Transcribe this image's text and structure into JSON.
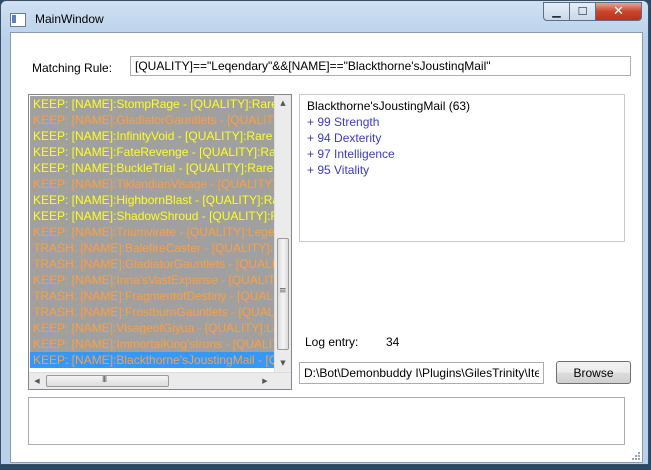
{
  "window": {
    "title": "MainWindow",
    "minimize_glyph": "▁",
    "maximize_glyph": "☐",
    "close_glyph": "✕"
  },
  "rule": {
    "label": "Matching Rule:",
    "value": "[QUALITY]==\"Leqendary\"&&[NAME]==\"Blackthorne'sJoustinqMail\""
  },
  "list": {
    "items": [
      {
        "text": "KEEP: [NAME]:StompRage - [QUALITY]:Rare - [",
        "color": "yellow"
      },
      {
        "text": "KEEP: [NAME]:GladiatorGauntlets - [QUALITY]:L",
        "color": "orange"
      },
      {
        "text": "KEEP: [NAME]:InfinityVoid - [QUALITY]:Rare - [",
        "color": "yellow"
      },
      {
        "text": "KEEP: [NAME]:FateRevenge - [QUALITY]:Rare -",
        "color": "yellow"
      },
      {
        "text": "KEEP: [NAME]:BuckleTrial - [QUALITY]:Rare - [",
        "color": "yellow"
      },
      {
        "text": "KEEP: [NAME]:TiklandianVisage - [QUALITY]:Le",
        "color": "orange"
      },
      {
        "text": "KEEP: [NAME]:HighbornBlast - [QUALITY]:Rare",
        "color": "yellow"
      },
      {
        "text": "KEEP: [NAME]:ShadowShroud - [QUALITY]:Rare",
        "color": "yellow"
      },
      {
        "text": "KEEP: [NAME]:Triumvirate - [QUALITY]:Legend",
        "color": "orange"
      },
      {
        "text": "TRASH: [NAME]:BalefireCaster - [QUALITY]:Leg",
        "color": "orange"
      },
      {
        "text": "TRASH: [NAME]:GladiatorGauntlets - [QUALITY]",
        "color": "orange"
      },
      {
        "text": "KEEP: [NAME]:Inna'sVastExpanse - [QUALITY]:L",
        "color": "orange"
      },
      {
        "text": "TRASH: [NAME]:FragmentofDestiny - [QUALITY",
        "color": "orange"
      },
      {
        "text": "TRASH: [NAME]:FrostburnGauntlets - [QUALITY",
        "color": "orange"
      },
      {
        "text": "KEEP: [NAME]:VisageofGiyua - [QUALITY]:Lege",
        "color": "orange"
      },
      {
        "text": "KEEP: [NAME]:ImmortalKing'sIrons - [QUALIT",
        "color": "orange"
      },
      {
        "text": "KEEP: [NAME]:Blackthorne'sJoustingMail - [QU",
        "color": "orange",
        "selected": true
      }
    ],
    "colors": {
      "yellow": "#ffff1a",
      "orange": "#ff9e3d",
      "background": "#a0a0a0",
      "selection": "#3399ff"
    }
  },
  "scrollbars": {
    "up_glyph": "▲",
    "down_glyph": "▼",
    "left_glyph": "◀",
    "right_glyph": "▶"
  },
  "details": {
    "title": "Blackthorne'sJoustingMail (63)",
    "stats": [
      "+ 99 Strength",
      "+ 94 Dexterity",
      "+ 97 Intelligence",
      "+ 95 Vitality"
    ],
    "stat_color": "#3b3bc4"
  },
  "log": {
    "label": "Log entry:",
    "value": "34"
  },
  "path": {
    "value": "D:\\Bot\\Demonbuddy I\\Plugins\\GilesTrinity\\Ite"
  },
  "browse": {
    "label": "Browse"
  }
}
